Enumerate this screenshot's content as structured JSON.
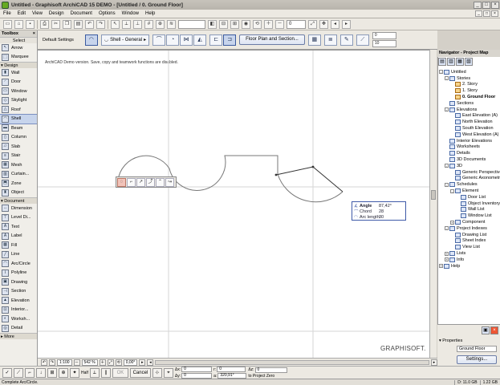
{
  "window": {
    "title": "Untitled - Graphisoft ArchiCAD 15 DEMO - [Untitled / 0. Ground Floor]",
    "controls": [
      "_",
      "□",
      "×"
    ]
  },
  "menu": {
    "items": [
      "File",
      "Edit",
      "View",
      "Design",
      "Document",
      "Options",
      "Window",
      "Help"
    ],
    "doc_controls": [
      "_",
      "□",
      "×"
    ]
  },
  "toolbar": {
    "layer_field": "",
    "zoom_field": "0"
  },
  "infobox": {
    "label": "Default Settings",
    "shell_type": "Shell - General",
    "floor_plan_button": "Floor Plan and Section...",
    "right_value_1": "0",
    "right_value_2": "10"
  },
  "toolbox": {
    "title": "Toolbox",
    "select_section": "Select",
    "select_items": [
      "Arrow",
      "Marquee"
    ],
    "design_section": "Design",
    "design_items": [
      "Wall",
      "Door",
      "Window",
      "Skylight",
      "Roof",
      "Shell",
      "Beam",
      "Column",
      "Slab",
      "Stair",
      "Mesh",
      "Curtain...",
      "Zone",
      "Object"
    ],
    "active_tool": "Shell",
    "document_section": "Document",
    "document_items": [
      "Dimension",
      "Level Di...",
      "Text",
      "Label",
      "Fill",
      "Line",
      "Arc/Circle",
      "Polyline",
      "Drawing",
      "Section",
      "Elevation",
      "Interior...",
      "Worksh...",
      "Detail"
    ],
    "more": "More"
  },
  "canvas": {
    "demo_notice": "ArchiCAD Demo version. Save, copy and teamwork functions are disabled.",
    "brand": "GRAPHISOFT."
  },
  "tracker": {
    "rows": [
      {
        "label": "Angle",
        "value": "87,42°"
      },
      {
        "label": "Chord",
        "value": "28"
      },
      {
        "label": "Arc length",
        "value": "30"
      }
    ]
  },
  "navigator": {
    "title": "Navigator - Project Map",
    "tree": [
      {
        "label": "Untitled",
        "level": 0,
        "exp": "-"
      },
      {
        "label": "Stories",
        "level": 1,
        "exp": "-"
      },
      {
        "label": "2. Story",
        "level": 2,
        "story": true
      },
      {
        "label": "1. Story",
        "level": 2,
        "story": true
      },
      {
        "label": "0. Ground Floor",
        "level": 2,
        "story": true,
        "bold": true
      },
      {
        "label": "Sections",
        "level": 1
      },
      {
        "label": "Elevations",
        "level": 1,
        "exp": "-"
      },
      {
        "label": "East Elevation (A)",
        "level": 2
      },
      {
        "label": "North Elevation",
        "level": 2
      },
      {
        "label": "South Elevation",
        "level": 2
      },
      {
        "label": "West Elevation (A)",
        "level": 2
      },
      {
        "label": "Interior Elevations",
        "level": 1
      },
      {
        "label": "Worksheets",
        "level": 1
      },
      {
        "label": "Details",
        "level": 1
      },
      {
        "label": "3D Documents",
        "level": 1
      },
      {
        "label": "3D",
        "level": 1,
        "exp": "-"
      },
      {
        "label": "Generic Perspective",
        "level": 2
      },
      {
        "label": "Generic Axonometry",
        "level": 2
      },
      {
        "label": "Schedules",
        "level": 1,
        "exp": "-"
      },
      {
        "label": "Element",
        "level": 2,
        "exp": "-"
      },
      {
        "label": "Door List",
        "level": 3
      },
      {
        "label": "Object Inventory",
        "level": 3
      },
      {
        "label": "Wall List",
        "level": 3
      },
      {
        "label": "Window List",
        "level": 3
      },
      {
        "label": "Component",
        "level": 2,
        "exp": "+"
      },
      {
        "label": "Project Indexes",
        "level": 1,
        "exp": "-"
      },
      {
        "label": "Drawing List",
        "level": 2
      },
      {
        "label": "Sheet Index",
        "level": 2
      },
      {
        "label": "View List",
        "level": 2
      },
      {
        "label": "Lists",
        "level": 1,
        "exp": "+"
      },
      {
        "label": "Info",
        "level": 1,
        "exp": "+"
      },
      {
        "label": "Help",
        "level": 0,
        "exp": "+"
      }
    ],
    "properties_label": "Properties",
    "properties_value": "Ground Floor",
    "settings_button": "Settings..."
  },
  "bottom": {
    "scale": "1:100",
    "zoom": "542 %",
    "angle": "0,00°"
  },
  "controlbox": {
    "half": "Half",
    "ok": "OK",
    "cancel": "Cancel",
    "dx_label": "Δx:",
    "dx_value": "0",
    "dy_label": "Δy:",
    "dy_value": "0",
    "r_label": "r:",
    "r_value": "0",
    "a_label": "a:",
    "a_value": "320,91°",
    "az_label": "Δz:",
    "az_value": "0",
    "to_label": "to Project Zero"
  },
  "status": {
    "text": "Complete Arc/Circle.",
    "disk": "D: 11.0 GB",
    "ram": "1.22 GB"
  }
}
